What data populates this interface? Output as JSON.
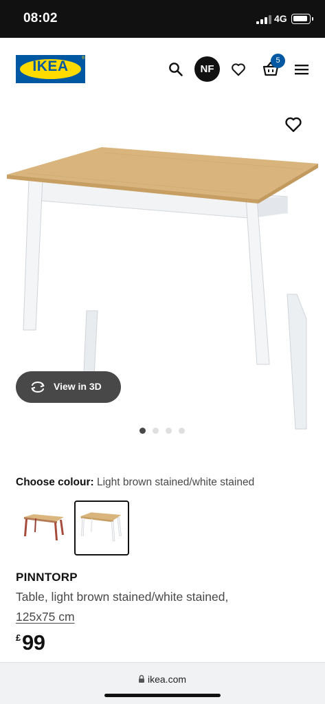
{
  "status_bar": {
    "time": "08:02",
    "network": "4G",
    "icons": [
      "signal-icon",
      "battery-icon"
    ]
  },
  "header": {
    "logo_text": "IKEA",
    "logo_reg": "®",
    "avatar_initials": "NF",
    "cart_count": "5",
    "icons": [
      "search-icon",
      "heart-icon",
      "basket-icon",
      "menu-icon"
    ],
    "colors": {
      "brand_blue": "#0058a3",
      "brand_yellow": "#ffdb00"
    }
  },
  "media": {
    "view3d_label": "View in 3D",
    "image_count": 4,
    "active_image": 1
  },
  "colour_chooser": {
    "label": "Choose colour:",
    "value": "Light brown stained/white stained",
    "options_count": 2,
    "selected_index": 2
  },
  "product": {
    "name": "PINNTORP",
    "description": "Table, light brown stained/white stained,",
    "size": "125x75 cm",
    "currency": "£",
    "price": "99"
  },
  "browser": {
    "url": "ikea.com"
  }
}
